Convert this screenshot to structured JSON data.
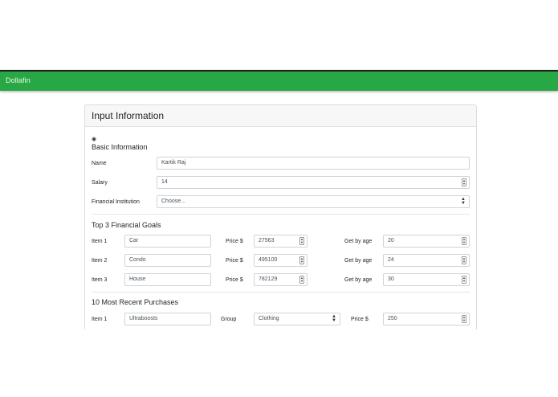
{
  "navbar": {
    "brand": "Dollafin"
  },
  "card": {
    "title": "Input Information"
  },
  "basic": {
    "radio_glyph": "◉",
    "title": "Basic Information",
    "name_label": "Name",
    "name_value": "Kartik Raj",
    "salary_label": "Salary",
    "salary_value": "14",
    "institution_label": "Financial Institution",
    "institution_value": "Choose..."
  },
  "goals": {
    "title": "Top 3 Financial Goals",
    "price_label": "Price $",
    "age_label": "Get by age",
    "items": [
      {
        "label": "Item 1",
        "name": "Car",
        "price": "27563",
        "age": "20"
      },
      {
        "label": "Item 2",
        "name": "Condo",
        "price": "495100",
        "age": "24"
      },
      {
        "label": "Item 3",
        "name": "House",
        "price": "782129",
        "age": "30"
      }
    ]
  },
  "purchases": {
    "title": "10 Most Recent Purchases",
    "items": [
      {
        "label": "Item 1",
        "name": "Ultraboosts",
        "group_label": "Group",
        "group": "Clothing",
        "price_label": "Price $",
        "price": "250"
      }
    ]
  },
  "icons": {
    "spinner": "spinner-icon",
    "select_caret": "select-caret-icon",
    "radio": "radio-icon"
  },
  "colors": {
    "navbar": "#28a745",
    "header_bg": "#f7f7f7",
    "border": "#ced4da"
  }
}
